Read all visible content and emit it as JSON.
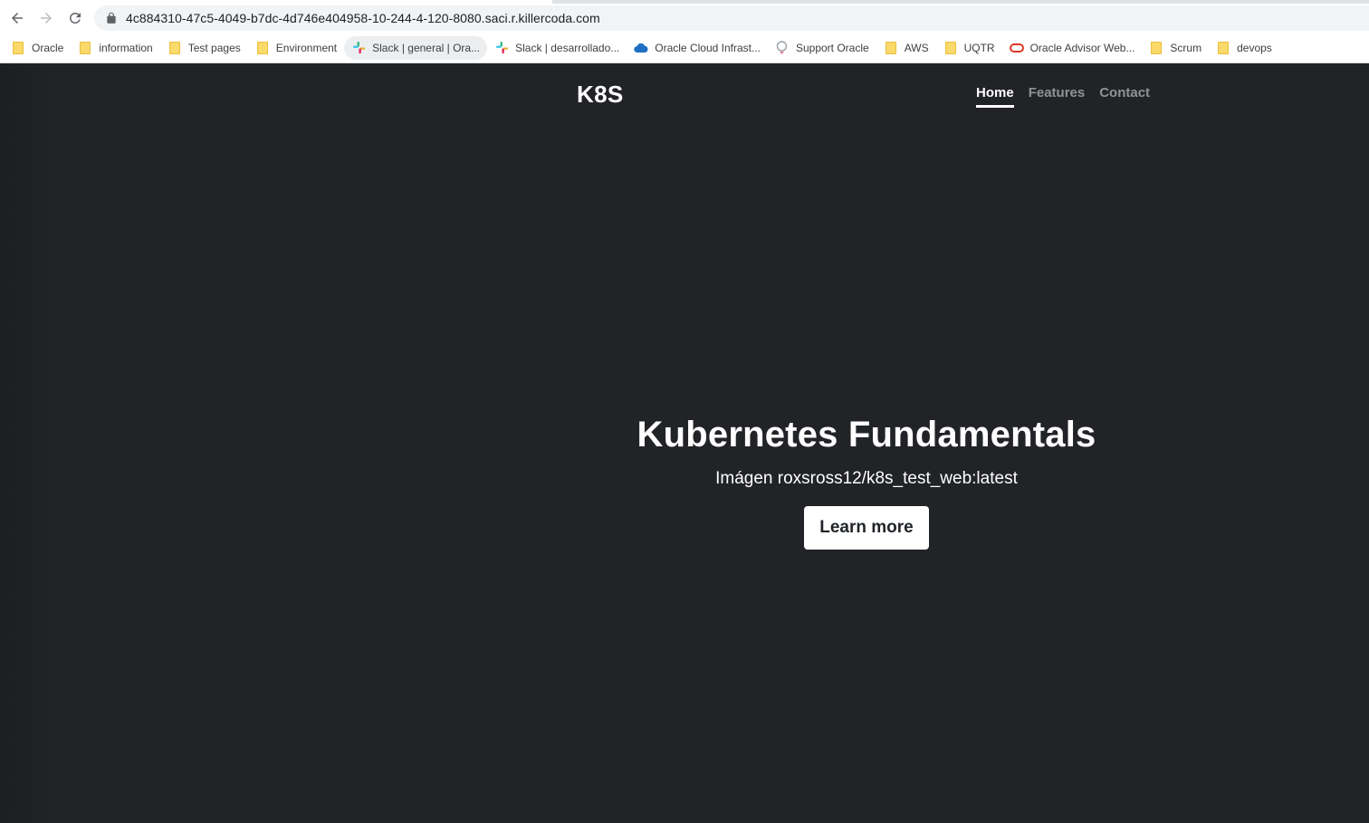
{
  "browser": {
    "url": "4c884310-47c5-4049-b7dc-4d746e404958-10-244-4-120-8080.saci.r.killercoda.com",
    "bookmarks": [
      {
        "label": "Oracle",
        "icon": "folder-icon"
      },
      {
        "label": "information",
        "icon": "folder-icon"
      },
      {
        "label": "Test pages",
        "icon": "folder-icon"
      },
      {
        "label": "Environment",
        "icon": "folder-icon"
      },
      {
        "label": "Slack | general | Ora...",
        "icon": "slack-icon"
      },
      {
        "label": "Slack | desarrollado...",
        "icon": "slack-icon"
      },
      {
        "label": "Oracle Cloud Infrast...",
        "icon": "cloud-icon"
      },
      {
        "label": "Support Oracle",
        "icon": "support-icon"
      },
      {
        "label": "AWS",
        "icon": "folder-icon"
      },
      {
        "label": "UQTR",
        "icon": "folder-icon"
      },
      {
        "label": "Oracle Advisor Web...",
        "icon": "oracle-icon"
      },
      {
        "label": "Scrum",
        "icon": "folder-icon"
      },
      {
        "label": "devops",
        "icon": "folder-icon"
      }
    ]
  },
  "site": {
    "brand": "K8S",
    "nav": [
      {
        "label": "Home",
        "active": true
      },
      {
        "label": "Features",
        "active": false
      },
      {
        "label": "Contact",
        "active": false
      }
    ],
    "hero": {
      "title": "Kubernetes Fundamentals",
      "subtitle": "Imágen roxsross12/k8s_test_web:latest",
      "button": "Learn more"
    }
  },
  "colors": {
    "page_background": "#212327",
    "text": "#ffffff",
    "nav_inactive": "#8a8b8d",
    "button_background": "#ffffff"
  }
}
